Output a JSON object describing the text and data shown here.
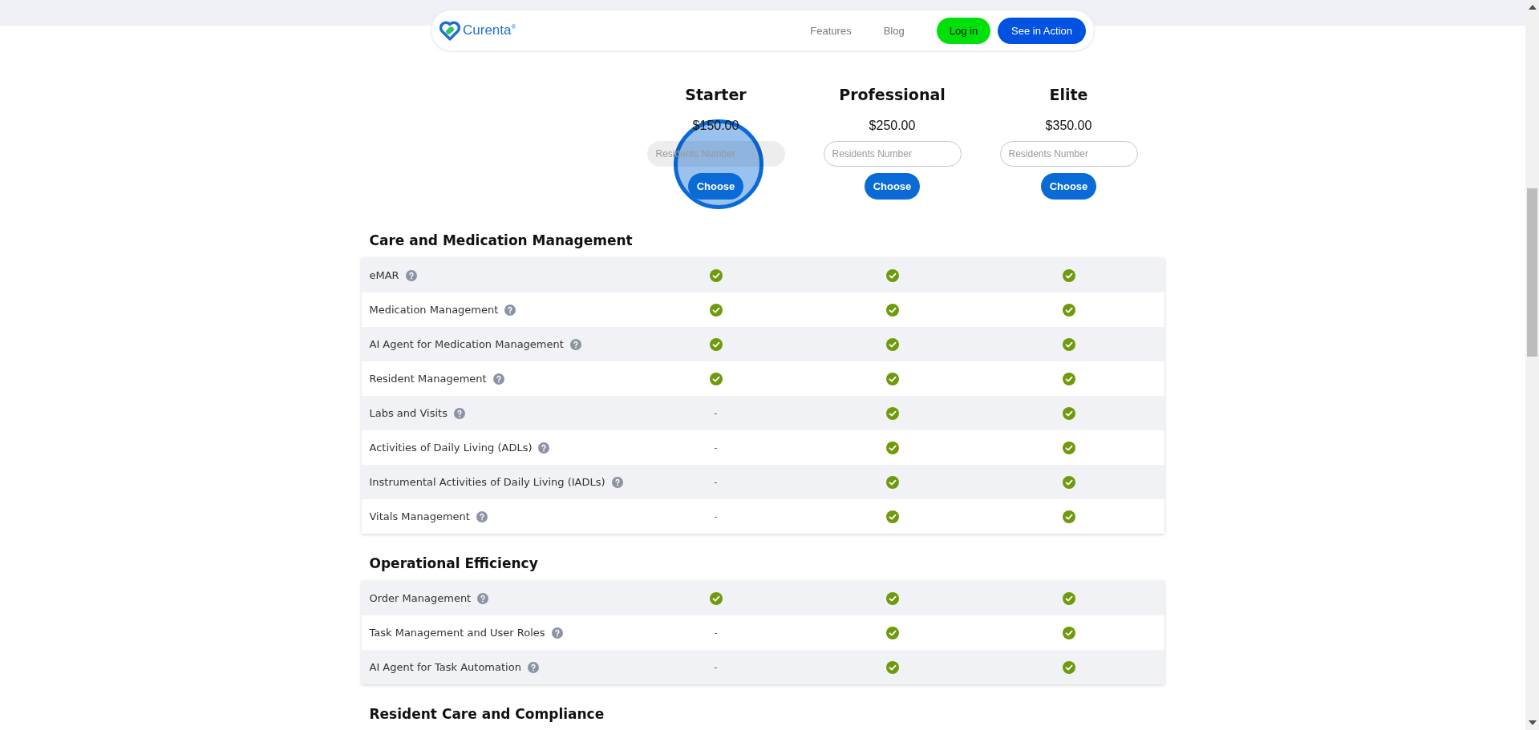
{
  "header": {
    "brand": "Curenta$^{®}$",
    "nav": [
      {
        "label": "Features"
      },
      {
        "label": "Blog"
      }
    ],
    "login": "Log in",
    "cta": "See in Action"
  },
  "plans": [
    {
      "name": "Starter",
      "price": "$150.00",
      "placeholder": "Residents Number",
      "focused": true,
      "click_marker": true,
      "button": "Choose"
    },
    {
      "name": "Professional",
      "price": "$250.00",
      "placeholder": "Residents Number",
      "focused": false,
      "click_marker": false,
      "button": "Choose"
    },
    {
      "name": "Elite",
      "price": "$350.00",
      "placeholder": "Residents Number",
      "focused": false,
      "click_marker": false,
      "button": "Choose"
    }
  ],
  "sections": [
    {
      "title": "Care and Medication Management",
      "rows": [
        {
          "feature": "eMAR",
          "cells": [
            {
              "included": true
            },
            {
              "included": true
            },
            {
              "included": true
            }
          ]
        },
        {
          "feature": "Medication Management",
          "cells": [
            {
              "included": true
            },
            {
              "included": true
            },
            {
              "included": true
            }
          ]
        },
        {
          "feature": "AI Agent for Medication Management",
          "cells": [
            {
              "included": true
            },
            {
              "included": true
            },
            {
              "included": true
            }
          ]
        },
        {
          "feature": "Resident Management",
          "cells": [
            {
              "included": true
            },
            {
              "included": true
            },
            {
              "included": true
            }
          ]
        },
        {
          "feature": "Labs and Visits",
          "cells": [
            {
              "included": false,
              "text": "-"
            },
            {
              "included": true
            },
            {
              "included": true
            }
          ]
        },
        {
          "feature": "Activities of Daily Living (ADLs)",
          "cells": [
            {
              "included": false,
              "text": "-"
            },
            {
              "included": true
            },
            {
              "included": true
            }
          ]
        },
        {
          "feature": "Instrumental Activities of Daily Living (IADLs)",
          "cells": [
            {
              "included": false,
              "text": "-"
            },
            {
              "included": true
            },
            {
              "included": true
            }
          ]
        },
        {
          "feature": "Vitals Management",
          "cells": [
            {
              "included": false,
              "text": "-"
            },
            {
              "included": true
            },
            {
              "included": true
            }
          ]
        }
      ]
    },
    {
      "title": "Operational Efficiency",
      "rows": [
        {
          "feature": "Order Management",
          "cells": [
            {
              "included": true
            },
            {
              "included": true
            },
            {
              "included": true
            }
          ]
        },
        {
          "feature": "Task Management and User Roles",
          "cells": [
            {
              "included": false,
              "text": "-"
            },
            {
              "included": true
            },
            {
              "included": true
            }
          ]
        },
        {
          "feature": "AI Agent for Task Automation",
          "cells": [
            {
              "included": false,
              "text": "-"
            },
            {
              "included": true
            },
            {
              "included": true
            }
          ]
        }
      ]
    },
    {
      "title": "Resident Care and Compliance"
    }
  ]
}
